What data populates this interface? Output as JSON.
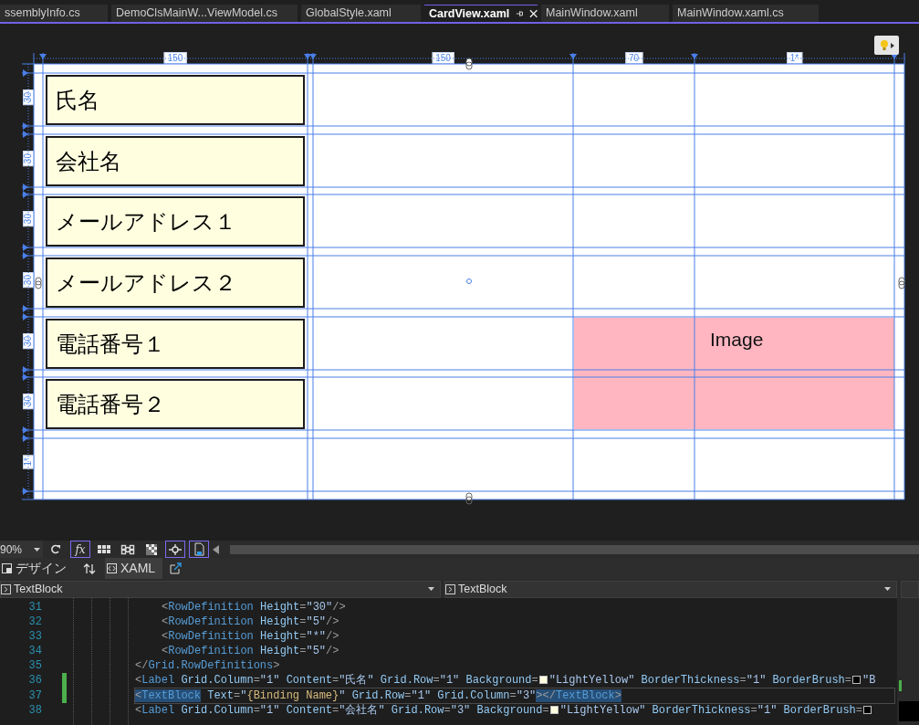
{
  "tabs": [
    {
      "label": "ssemblyInfo.cs",
      "selected": false
    },
    {
      "label": "DemoClsMainW...ViewModel.cs",
      "selected": false
    },
    {
      "label": "GlobalStyle.xaml",
      "selected": false
    },
    {
      "label": "CardView.xaml",
      "selected": true
    },
    {
      "label": "MainWindow.xaml",
      "selected": false
    },
    {
      "label": "MainWindow.xaml.cs",
      "selected": false
    }
  ],
  "designer": {
    "column_rulers": [
      "150",
      "150",
      "70",
      "1*"
    ],
    "row_rulers": [
      "30",
      "30",
      "30",
      "30",
      "30",
      "30",
      "1*"
    ],
    "labels": [
      "氏名",
      "会社名",
      "メールアドレス１",
      "メールアドレス２",
      "電話番号１",
      "電話番号２"
    ],
    "image": {
      "text": "Image"
    }
  },
  "toolbar": {
    "zoom": "90%",
    "tools": [
      {
        "kind": "refresh",
        "on": false
      },
      {
        "kind": "fx",
        "label": "fx",
        "on": true
      },
      {
        "kind": "grid",
        "on": false
      },
      {
        "kind": "snap-grid",
        "on": false
      },
      {
        "kind": "checker",
        "on": false
      },
      {
        "kind": "snap-point",
        "on": true
      },
      {
        "kind": "project-code",
        "on": true
      }
    ]
  },
  "view_tabs": [
    {
      "label": "デザイン",
      "selected": false
    },
    {
      "label": "XAML",
      "selected": true
    }
  ],
  "dropdowns": [
    {
      "value": "TextBlock"
    },
    {
      "value": "TextBlock"
    }
  ],
  "code": [
    {
      "children": [
        {
          "number": "31",
          "changed": false,
          "current": false,
          "tokens": [
            {
              "kind": "p",
              "text": "<"
            },
            {
              "kind": "tag",
              "text": "RowDefinition"
            },
            {
              "kind": "attr",
              "text": " Height"
            },
            {
              "kind": "p",
              "text": "="
            },
            {
              "kind": "str",
              "text": "\"30\""
            },
            {
              "kind": "p",
              "text": "/>"
            }
          ]
        },
        {
          "number": "32",
          "changed": false,
          "current": false,
          "tokens": [
            {
              "kind": "p",
              "text": "<"
            },
            {
              "kind": "tag",
              "text": "RowDefinition"
            },
            {
              "kind": "attr",
              "text": " Height"
            },
            {
              "kind": "p",
              "text": "="
            },
            {
              "kind": "str",
              "text": "\"5\""
            },
            {
              "kind": "p",
              "text": "/>"
            }
          ]
        },
        {
          "number": "33",
          "changed": false,
          "current": false,
          "tokens": [
            {
              "kind": "p",
              "text": "<"
            },
            {
              "kind": "tag",
              "text": "RowDefinition"
            },
            {
              "kind": "attr",
              "text": " Height"
            },
            {
              "kind": "p",
              "text": "="
            },
            {
              "kind": "str",
              "text": "\"*\""
            },
            {
              "kind": "p",
              "text": "/>"
            }
          ]
        },
        {
          "number": "34",
          "changed": false,
          "current": false,
          "tokens": [
            {
              "kind": "p",
              "text": "<"
            },
            {
              "kind": "tag",
              "text": "RowDefinition"
            },
            {
              "kind": "attr",
              "text": " Height"
            },
            {
              "kind": "p",
              "text": "="
            },
            {
              "kind": "str",
              "text": "\"5\""
            },
            {
              "kind": "p",
              "text": "/>"
            }
          ]
        }
      ]
    },
    {
      "number": "35",
      "changed": false,
      "current": false,
      "tokens": [
        {
          "kind": "p",
          "text": "</"
        },
        {
          "kind": "tag",
          "text": "Grid.RowDefinitions"
        },
        {
          "kind": "p",
          "text": ">"
        }
      ]
    },
    {
      "number": "36",
      "changed": true,
      "current": false,
      "tokens": [
        {
          "kind": "p",
          "text": "<"
        },
        {
          "kind": "tag",
          "text": "Label"
        },
        {
          "kind": "attr",
          "text": " Grid.Column"
        },
        {
          "kind": "p",
          "text": "="
        },
        {
          "kind": "str",
          "text": "\"1\""
        },
        {
          "kind": "attr",
          "text": " Content"
        },
        {
          "kind": "p",
          "text": "="
        },
        {
          "kind": "str",
          "text": "\"氏名\""
        },
        {
          "kind": "attr",
          "text": " Grid.Row"
        },
        {
          "kind": "p",
          "text": "="
        },
        {
          "kind": "str",
          "text": "\"1\""
        },
        {
          "kind": "attr",
          "text": " Background"
        },
        {
          "kind": "p",
          "text": "="
        },
        {
          "kind": "swatch",
          "color": "#ffffe0"
        },
        {
          "kind": "str",
          "text": "\"LightYellow\""
        },
        {
          "kind": "attr",
          "text": " BorderThickness"
        },
        {
          "kind": "p",
          "text": "="
        },
        {
          "kind": "str",
          "text": "\"1\""
        },
        {
          "kind": "attr",
          "text": " BorderBrush"
        },
        {
          "kind": "p",
          "text": "="
        },
        {
          "kind": "swatch",
          "color": "#000000"
        },
        {
          "kind": "str",
          "text": "\"B"
        }
      ]
    },
    {
      "number": "37",
      "changed": true,
      "current": true,
      "tokens": [
        {
          "kind": "p",
          "text": "<",
          "highlighted": true
        },
        {
          "kind": "tag",
          "text": "TextBlock",
          "highlighted": true
        },
        {
          "kind": "attr",
          "text": " Text"
        },
        {
          "kind": "p",
          "text": "="
        },
        {
          "kind": "str",
          "text": "\""
        },
        {
          "kind": "ext",
          "text": "{Binding Name}"
        },
        {
          "kind": "str",
          "text": "\""
        },
        {
          "kind": "attr",
          "text": " Grid.Row"
        },
        {
          "kind": "p",
          "text": "="
        },
        {
          "kind": "str",
          "text": "\"1\""
        },
        {
          "kind": "attr",
          "text": " Grid.Column"
        },
        {
          "kind": "p",
          "text": "="
        },
        {
          "kind": "str",
          "text": "\"3\""
        },
        {
          "kind": "p",
          "text": "></",
          "highlighted": true
        },
        {
          "kind": "tag",
          "text": "TextBlock",
          "highlighted": true
        },
        {
          "kind": "p",
          "text": ">",
          "highlighted": true
        }
      ]
    },
    {
      "number": "38",
      "changed": false,
      "current": false,
      "tokens": [
        {
          "kind": "p",
          "text": "<"
        },
        {
          "kind": "tag",
          "text": "Label"
        },
        {
          "kind": "attr",
          "text": " Grid.Column"
        },
        {
          "kind": "p",
          "text": "="
        },
        {
          "kind": "str",
          "text": "\"1\""
        },
        {
          "kind": "attr",
          "text": " Content"
        },
        {
          "kind": "p",
          "text": "="
        },
        {
          "kind": "str",
          "text": "\"会社名\""
        },
        {
          "kind": "attr",
          "text": " Grid.Row"
        },
        {
          "kind": "p",
          "text": "="
        },
        {
          "kind": "str",
          "text": "\"3\""
        },
        {
          "kind": "attr",
          "text": " Background"
        },
        {
          "kind": "p",
          "text": "="
        },
        {
          "kind": "swatch",
          "color": "#ffffe0"
        },
        {
          "kind": "str",
          "text": "\"LightYellow\""
        },
        {
          "kind": "attr",
          "text": " BorderThickness"
        },
        {
          "kind": "p",
          "text": "="
        },
        {
          "kind": "str",
          "text": "\"1\""
        },
        {
          "kind": "attr",
          "text": " BorderBrush"
        },
        {
          "kind": "p",
          "text": "="
        },
        {
          "kind": "swatch",
          "color": "#000000"
        }
      ]
    }
  ]
}
